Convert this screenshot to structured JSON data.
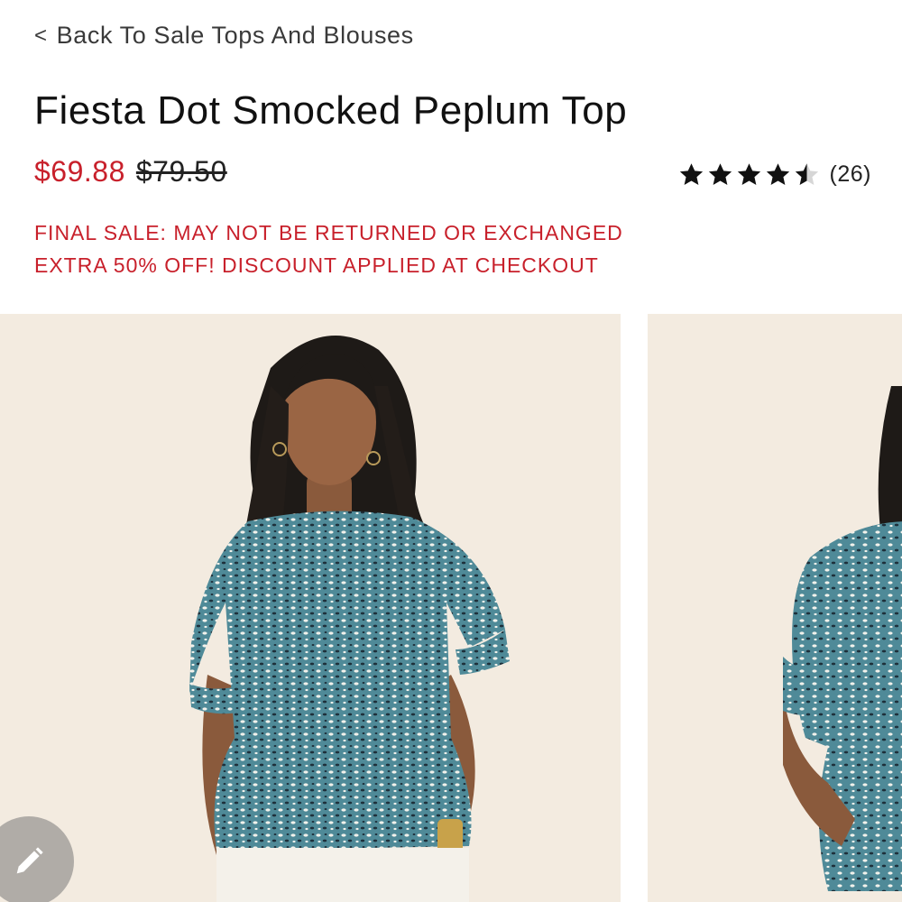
{
  "nav": {
    "back_label": "Back To Sale Tops And Blouses",
    "back_icon": "chevron-left-icon"
  },
  "product": {
    "title": "Fiesta Dot Smocked Peplum Top",
    "sale_price": "$69.88",
    "original_price": "$79.50",
    "rating": {
      "value": 4.5,
      "max": 5,
      "review_count": "(26)"
    },
    "promos": [
      "FINAL SALE: MAY NOT BE RETURNED OR EXCHANGED",
      "EXTRA 50% OFF! DISCOUNT APPLIED AT CHECKOUT"
    ]
  },
  "gallery": {
    "slides": [
      {
        "alt": "model front"
      },
      {
        "alt": "model side"
      }
    ]
  },
  "fab": {
    "icon": "pencil-icon"
  },
  "colors": {
    "sale": "#c8202b",
    "text": "#111111",
    "photo_bg": "#f3ebe0",
    "top_print": "#4f8a98"
  }
}
